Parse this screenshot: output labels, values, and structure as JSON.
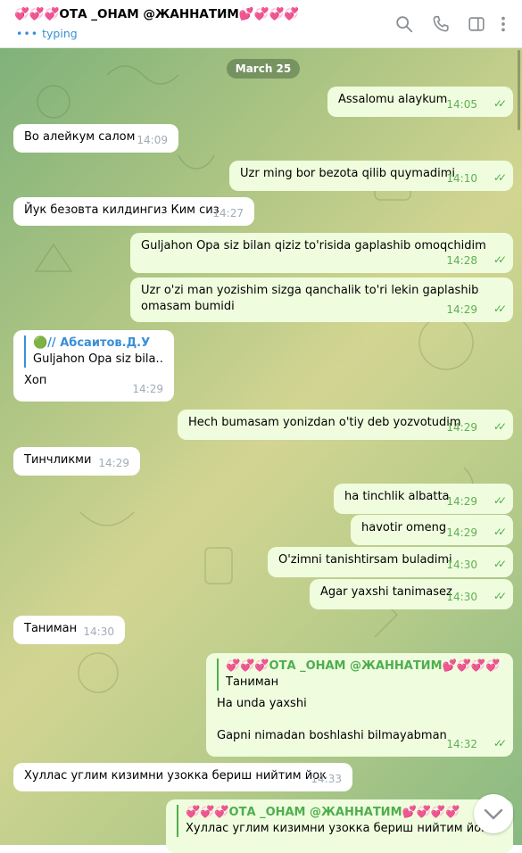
{
  "header": {
    "title": "💞💞💞ОТА _ОНАМ @ЖАННАТИМ💕💞💞💞",
    "status": "typing",
    "icons": [
      "search-icon",
      "phone-icon",
      "sidebar-icon",
      "more-icon"
    ]
  },
  "date_separator": "March 25",
  "messages": [
    {
      "text": "Assalomu alaykum",
      "time": "14:05"
    },
    {
      "text": "Во алейкум салом",
      "time": "14:09"
    },
    {
      "text": "Uzr ming bor bezota qilib quymadimi",
      "time": "14:10"
    },
    {
      "text": "Йук безовта килдингиз Ким сиз",
      "time": "14:27"
    },
    {
      "text": "Guljahon Opa siz bilan qiziz to'risida gaplashib omoqchidim",
      "time": "14:28"
    },
    {
      "text": "Uzr o'zi man yozishim sizga qanchalik to'ri lekin gaplashib omasam bumidi",
      "time": "14:29"
    },
    {
      "reply_name": "🟢// Абсаитов.Д.У",
      "reply_text": "Guljahon Opa siz bila…",
      "text": "Хоп",
      "time": "14:29"
    },
    {
      "text": "Hech bumasam yonizdan o'tiy deb yozvotudim",
      "time": "14:29"
    },
    {
      "text": "Тинчликми",
      "time": "14:29"
    },
    {
      "text": "ha tinchlik albatta",
      "time": "14:29"
    },
    {
      "text": "havotir omeng",
      "time": "14:29"
    },
    {
      "text": "O'zimni tanishtirsam buladimi",
      "time": "14:30"
    },
    {
      "text": "Agar yaxshi tanimasez",
      "time": "14:30"
    },
    {
      "text": "Таниман",
      "time": "14:30"
    },
    {
      "reply_name": "💞💞💞ОТА _ОНАМ @ЖАННАТИМ💕💞💞💞",
      "reply_text": "Таниман",
      "text": "Ha unda yaxshi",
      "text2": "Gapni nimadan boshlashi bilmayabman",
      "time": "14:32"
    },
    {
      "text": "Хуллас углим кизимни узокка бериш нийтим йок",
      "time": "14:33"
    },
    {
      "reply_name": "💞💞💞ОТА _ОНАМ @ЖАННАТИМ💕💞💞💞",
      "reply_text": "Хуллас углим кизимни узокка бериш нийтим йок"
    }
  ]
}
